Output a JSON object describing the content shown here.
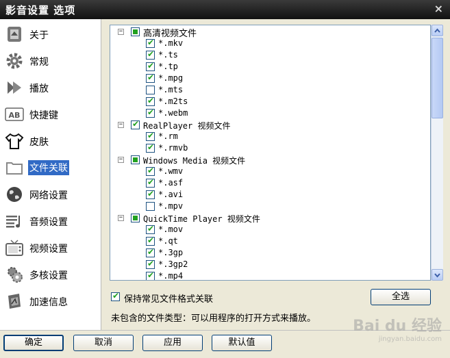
{
  "window": {
    "title": "影音设置 选项",
    "close_glyph": "×"
  },
  "sidebar": {
    "items": [
      {
        "label": "关于",
        "icon": "about-icon",
        "active": false
      },
      {
        "label": "常规",
        "icon": "gear-icon",
        "active": false
      },
      {
        "label": "播放",
        "icon": "play-icon",
        "active": false
      },
      {
        "label": "快捷键",
        "icon": "keyboard-icon",
        "active": false
      },
      {
        "label": "皮肤",
        "icon": "skin-shirt-icon",
        "active": false
      },
      {
        "label": "文件关联",
        "icon": "folder-icon",
        "active": true
      },
      {
        "label": "网络设置",
        "icon": "globe-icon",
        "active": false
      },
      {
        "label": "音频设置",
        "icon": "audio-icon",
        "active": false
      },
      {
        "label": "视频设置",
        "icon": "tv-icon",
        "active": false
      },
      {
        "label": "多核设置",
        "icon": "multicore-gear-icon",
        "active": false
      },
      {
        "label": "加速信息",
        "icon": "acceleration-icon",
        "active": false
      }
    ]
  },
  "tree": {
    "groups": [
      {
        "label": "高清视频文件",
        "state": "partial",
        "items": [
          {
            "label": "*.mkv",
            "checked": true
          },
          {
            "label": "*.ts",
            "checked": true
          },
          {
            "label": "*.tp",
            "checked": true
          },
          {
            "label": "*.mpg",
            "checked": true
          },
          {
            "label": "*.mts",
            "checked": false
          },
          {
            "label": "*.m2ts",
            "checked": true
          },
          {
            "label": "*.webm",
            "checked": true
          }
        ]
      },
      {
        "label": "RealPlayer 视频文件",
        "state": "checked",
        "items": [
          {
            "label": "*.rm",
            "checked": true
          },
          {
            "label": "*.rmvb",
            "checked": true
          }
        ]
      },
      {
        "label": "Windows Media 视频文件",
        "state": "partial",
        "items": [
          {
            "label": "*.wmv",
            "checked": true
          },
          {
            "label": "*.asf",
            "checked": true
          },
          {
            "label": "*.avi",
            "checked": true
          },
          {
            "label": "*.mpv",
            "checked": false
          }
        ]
      },
      {
        "label": "QuickTime Player 视频文件",
        "state": "partial",
        "items": [
          {
            "label": "*.mov",
            "checked": true
          },
          {
            "label": "*.qt",
            "checked": true
          },
          {
            "label": "*.3gp",
            "checked": true
          },
          {
            "label": "*.3gp2",
            "checked": true
          },
          {
            "label": "*.mp4",
            "checked": true
          }
        ]
      }
    ],
    "expander_glyph": "−"
  },
  "options": {
    "keep_assoc_label": "保持常见文件格式关联",
    "keep_assoc_checked": true,
    "select_all_label": "全选",
    "note": "未包含的文件类型：可以用程序的打开方式来播放。"
  },
  "footer": {
    "ok_label": "确定",
    "cancel_label": "取消",
    "apply_label": "应用",
    "default_label": "默认值"
  },
  "watermark": {
    "main": "Bai du 经验",
    "sub": "jingyan.baidu.com"
  },
  "colors": {
    "check": "#21a121",
    "selection": "#316ac5",
    "titlebar": "#1a1a1a"
  }
}
